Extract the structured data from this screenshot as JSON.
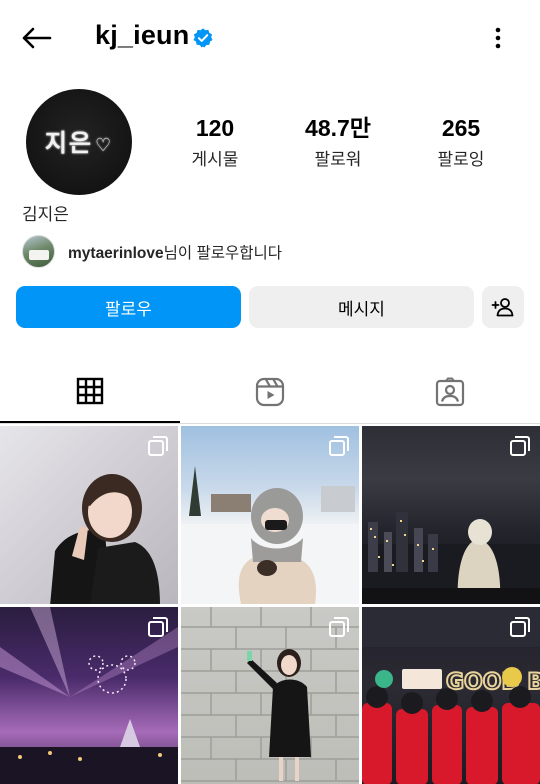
{
  "header": {
    "username": "kj_ieun",
    "verified": true
  },
  "profile": {
    "avatar_text": "지은",
    "avatar_heart": "♡",
    "fullname": "김지은",
    "stats": [
      {
        "value": "120",
        "label": "게시물"
      },
      {
        "value": "48.7만",
        "label": "팔로워"
      },
      {
        "value": "265",
        "label": "팔로잉"
      }
    ],
    "followed_by": {
      "user": "mytaerinlove",
      "suffix": "님이 팔로우합니다"
    }
  },
  "actions": {
    "follow_label": "팔로우",
    "message_label": "메시지"
  },
  "tabs": [
    {
      "icon": "grid-icon",
      "active": true
    },
    {
      "icon": "reels-icon",
      "active": false
    },
    {
      "icon": "tagged-icon",
      "active": false
    }
  ],
  "posts": {
    "t6_sign_text": "GOOD BY"
  },
  "colors": {
    "accent": "#0095f6",
    "verified": "#0095f6",
    "secondary_button": "#efefef"
  }
}
